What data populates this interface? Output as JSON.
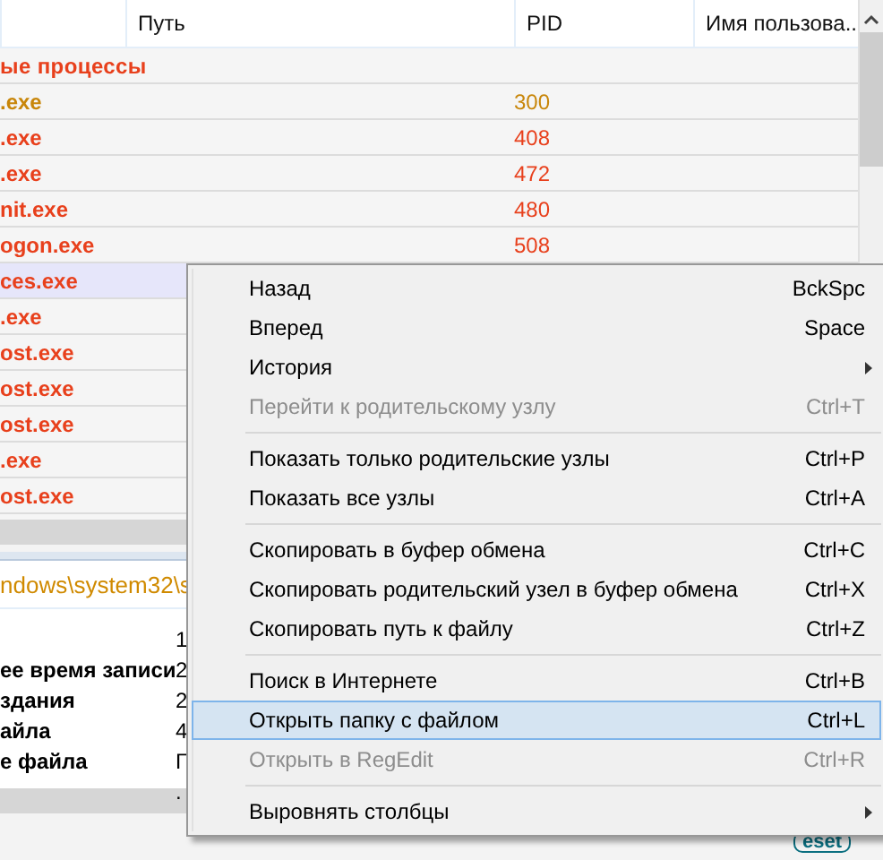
{
  "table": {
    "columns": [
      "",
      "Путь",
      "PID",
      "Имя пользова.."
    ],
    "rows": [
      {
        "kind": "group",
        "name": "ые процессы",
        "color": "#e8401c",
        "selected": false
      },
      {
        "kind": "process",
        "name": ".exe",
        "pid": "300",
        "color": "#c8860a",
        "selected": false
      },
      {
        "kind": "process",
        "name": ".exe",
        "pid": "408",
        "color": "#e8401c",
        "selected": false
      },
      {
        "kind": "process",
        "name": ".exe",
        "pid": "472",
        "color": "#e8401c",
        "selected": false
      },
      {
        "kind": "process",
        "name": "nit.exe",
        "pid": "480",
        "color": "#e8401c",
        "selected": false
      },
      {
        "kind": "process",
        "name": "ogon.exe",
        "pid": "508",
        "color": "#e8401c",
        "selected": false
      },
      {
        "kind": "process",
        "name": "ces.exe",
        "color": "#e8401c",
        "selected": true
      },
      {
        "kind": "process",
        "name": ".exe",
        "color": "#e8401c",
        "selected": false
      },
      {
        "kind": "process",
        "name": "ost.exe",
        "color": "#e8401c",
        "selected": false
      },
      {
        "kind": "process",
        "name": "ost.exe",
        "color": "#e8401c",
        "selected": false
      },
      {
        "kind": "process",
        "name": "ost.exe",
        "color": "#e8401c",
        "selected": false
      },
      {
        "kind": "process",
        "name": ".exe",
        "color": "#e8401c",
        "selected": false
      },
      {
        "kind": "process",
        "name": "ost.exe",
        "color": "#e8401c",
        "selected": false
      }
    ]
  },
  "details": {
    "path": "ndows\\system32\\s",
    "rows": [
      {
        "value": "1"
      },
      {
        "label": "ее время записи",
        "value": "2"
      },
      {
        "label": "здания",
        "value": "2"
      },
      {
        "label": "айла",
        "value": "4"
      },
      {
        "label": "е файла",
        "value": "Г"
      },
      {
        "value": "."
      }
    ]
  },
  "logo": "eset",
  "context_menu": [
    {
      "kind": "item",
      "label": "Назад",
      "shortcut": "BckSpc",
      "disabled": false,
      "selected": false
    },
    {
      "kind": "item",
      "label": "Вперед",
      "shortcut": "Space",
      "disabled": false,
      "selected": false
    },
    {
      "kind": "submenu",
      "label": "История",
      "disabled": false,
      "selected": false
    },
    {
      "kind": "item",
      "label": "Перейти к родительскому узлу",
      "shortcut": "Ctrl+T",
      "disabled": true,
      "selected": false
    },
    {
      "kind": "separator"
    },
    {
      "kind": "item",
      "label": "Показать только родительские узлы",
      "shortcut": "Ctrl+P",
      "disabled": false,
      "selected": false
    },
    {
      "kind": "item",
      "label": "Показать все узлы",
      "shortcut": "Ctrl+A",
      "disabled": false,
      "selected": false
    },
    {
      "kind": "separator"
    },
    {
      "kind": "item",
      "label": "Скопировать в буфер обмена",
      "shortcut": "Ctrl+C",
      "disabled": false,
      "selected": false
    },
    {
      "kind": "item",
      "label": "Скопировать родительский узел в буфер обмена",
      "shortcut": "Ctrl+X",
      "disabled": false,
      "selected": false
    },
    {
      "kind": "item",
      "label": "Скопировать путь к файлу",
      "shortcut": "Ctrl+Z",
      "disabled": false,
      "selected": false
    },
    {
      "kind": "separator"
    },
    {
      "kind": "item",
      "label": "Поиск в Интернете",
      "shortcut": "Ctrl+B",
      "disabled": false,
      "selected": false
    },
    {
      "kind": "item",
      "label": "Открыть папку с файлом",
      "shortcut": "Ctrl+L",
      "disabled": false,
      "selected": true
    },
    {
      "kind": "item",
      "label": "Открыть в RegEdit",
      "shortcut": "Ctrl+R",
      "disabled": true,
      "selected": false
    },
    {
      "kind": "separator"
    },
    {
      "kind": "submenu",
      "label": "Выровнять столбцы",
      "disabled": false,
      "selected": false
    }
  ]
}
